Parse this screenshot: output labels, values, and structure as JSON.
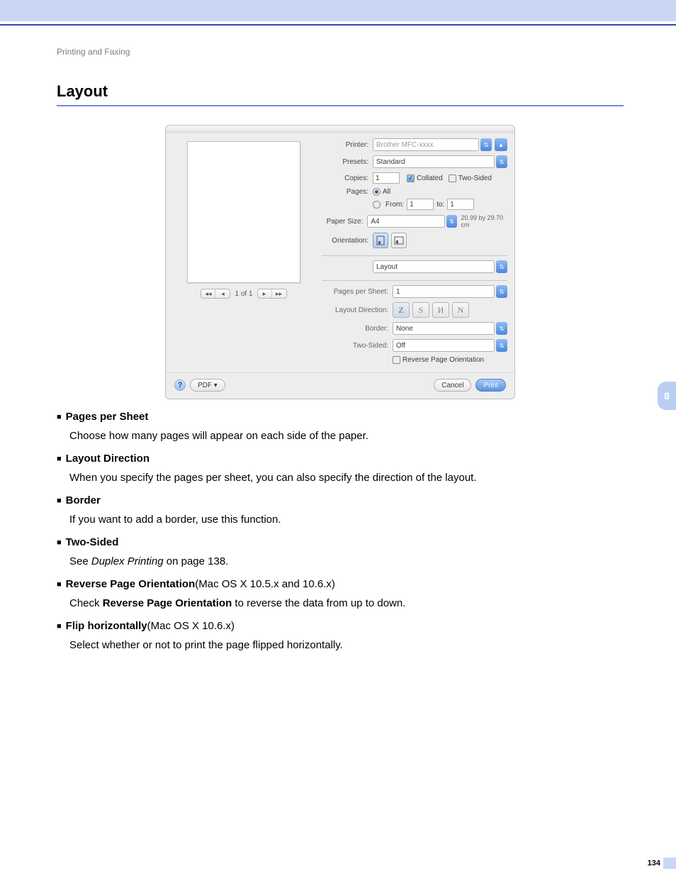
{
  "header": {
    "kicker": "Printing and Faxing",
    "title": "Layout"
  },
  "sidebar": {
    "chapter": "8"
  },
  "footer": {
    "page": "134"
  },
  "dialog": {
    "printer": {
      "label": "Printer:",
      "value": "Brother MFC-xxxx"
    },
    "presets": {
      "label": "Presets:",
      "value": "Standard"
    },
    "copies": {
      "label": "Copies:",
      "value": "1",
      "collated_label": "Collated",
      "collated_checked": true,
      "two_sided_label": "Two-Sided",
      "two_sided_checked": false
    },
    "pages": {
      "label": "Pages:",
      "all_label": "All",
      "from_label": "From:",
      "from_value": "1",
      "to_label": "to:",
      "to_value": "1"
    },
    "paper_size": {
      "label": "Paper Size:",
      "value": "A4",
      "dims": "20.99 by 29.70 cm"
    },
    "orientation": {
      "label": "Orientation:"
    },
    "section_select": "Layout",
    "pps": {
      "label": "Pages per Sheet:",
      "value": "1"
    },
    "layout_direction": {
      "label": "Layout Direction:"
    },
    "border": {
      "label": "Border:",
      "value": "None"
    },
    "two_sided": {
      "label": "Two-Sided:",
      "value": "Off"
    },
    "reverse": {
      "label": "Reverse Page Orientation",
      "checked": false
    },
    "pager": {
      "text": "1 of 1"
    },
    "footer": {
      "pdf": "PDF ▾",
      "cancel": "Cancel",
      "print": "Print"
    }
  },
  "bullets": {
    "pps": {
      "title": "Pages per Sheet",
      "body": "Choose how many pages will appear on each side of the paper."
    },
    "ld": {
      "title": "Layout Direction",
      "body": "When you specify the pages per sheet, you can also specify the direction of the layout."
    },
    "bd": {
      "title": "Border",
      "body": "If you want to add a border, use this function."
    },
    "ts": {
      "title": "Two-Sided",
      "body_pre": "See ",
      "body_link": "Duplex Printing",
      "body_post": " on page 138."
    },
    "rp": {
      "title": "Reverse Page Orientation",
      "note": " (Mac OS X 10.5.x and 10.6.x)",
      "body_pre": "Check ",
      "body_bold": "Reverse Page Orientation",
      "body_post": " to reverse the data from up to down."
    },
    "fh": {
      "title": "Flip horizontally",
      "note": " (Mac OS X 10.6.x)",
      "body": "Select whether or not to print the page flipped horizontally."
    }
  }
}
